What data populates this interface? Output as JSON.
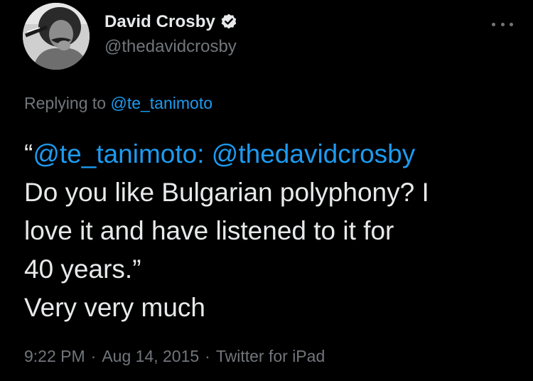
{
  "author": {
    "display_name": "David Crosby",
    "handle": "@thedavidcrosby",
    "verified": true
  },
  "reply": {
    "prefix": "Replying to ",
    "to_handle": "@te_tanimoto"
  },
  "tweet": {
    "quote_open": "“",
    "quoted_mention_1": "@te_tanimoto:",
    "quoted_mention_2": "@thedavidcrosby",
    "line_2": "Do you like Bulgarian polyphony? I",
    "line_3": "love it and have listened to it for",
    "line_4": "40 years.”",
    "line_5": "Very very much"
  },
  "meta": {
    "time": "9:22 PM",
    "date": "Aug 14, 2015",
    "source": "Twitter for iPad",
    "separator": "·"
  },
  "icons": {
    "verified": "verified-badge-icon",
    "more": "more-options-icon"
  },
  "colors": {
    "background": "#000000",
    "text": "#e7e9ea",
    "secondary": "#71767b",
    "link": "#1d9bf0"
  }
}
